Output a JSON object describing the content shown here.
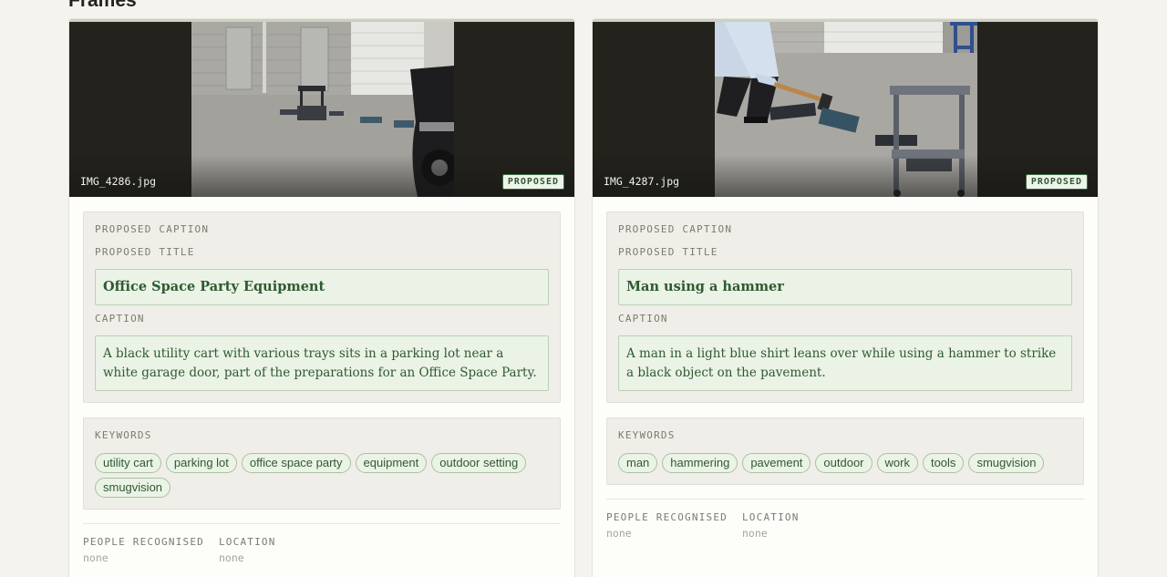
{
  "section": {
    "title": "Frames"
  },
  "labels": {
    "proposed_caption": "PROPOSED CAPTION",
    "proposed_title": "PROPOSED TITLE",
    "caption": "CAPTION",
    "keywords": "KEYWORDS",
    "people": "PEOPLE RECOGNISED",
    "location": "LOCATION"
  },
  "cards": [
    {
      "filename": "IMG_4286.jpg",
      "status": "PROPOSED",
      "title": "Office Space Party Equipment",
      "caption": "A black utility cart with various trays sits in a parking lot near a white garage door, part of the preparations for an Office Space Party.",
      "keywords": [
        "utility cart",
        "parking lot",
        "office space party",
        "equipment",
        "outdoor setting",
        "smugvision"
      ],
      "people": "none",
      "location": "none"
    },
    {
      "filename": "IMG_4287.jpg",
      "status": "PROPOSED",
      "title": "Man using a hammer",
      "caption": "A man in a light blue shirt leans over while using a hammer to strike a black object on the pavement.",
      "keywords": [
        "man",
        "hammering",
        "pavement",
        "outdoor",
        "work",
        "tools",
        "smugvision"
      ],
      "people": "none",
      "location": "none"
    }
  ],
  "colors": {
    "accent_green": "#2e5a30",
    "field_bg": "#ebf2e6",
    "panel_bg": "#f0eee8",
    "thumb_bg": "#23221d"
  },
  "icons": []
}
